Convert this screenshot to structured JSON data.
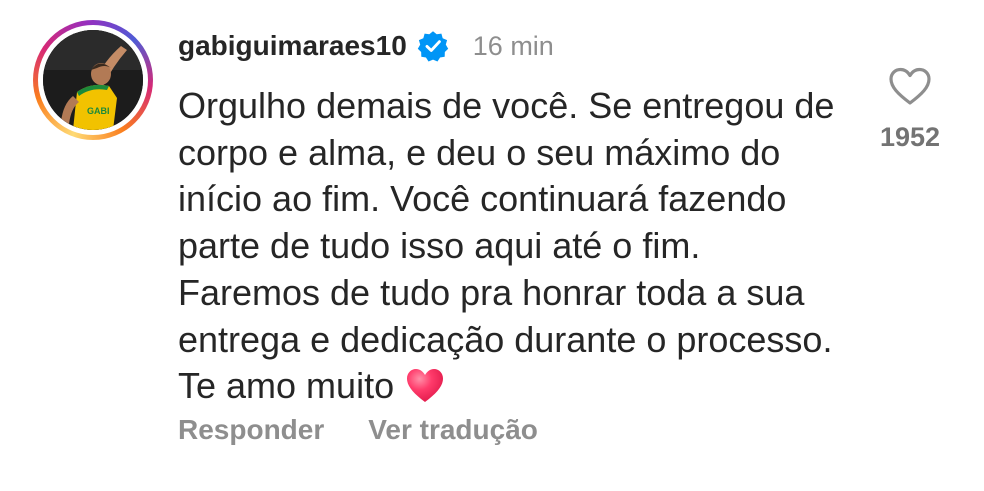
{
  "comment": {
    "username": "gabiguimaraes10",
    "verified": true,
    "timestamp": "16 min",
    "text": "Orgulho demais de você. Se entregou de corpo e alma, e deu o seu máximo do início ao fim. Você continuará fazendo parte de tudo isso aqui até o fim. Faremos de tudo pra honrar toda a sua entrega e dedicação durante o processo. Te amo muito",
    "emoji": "red-heart",
    "likes": "1952"
  },
  "actions": {
    "reply_label": "Responder",
    "translate_label": "Ver tradução"
  },
  "colors": {
    "text": "#262626",
    "muted": "#8e8e8e",
    "verified_blue": "#0095f6",
    "heart_emoji": "#ff3b6b"
  },
  "avatar": {
    "jersey_text": "GABI"
  }
}
